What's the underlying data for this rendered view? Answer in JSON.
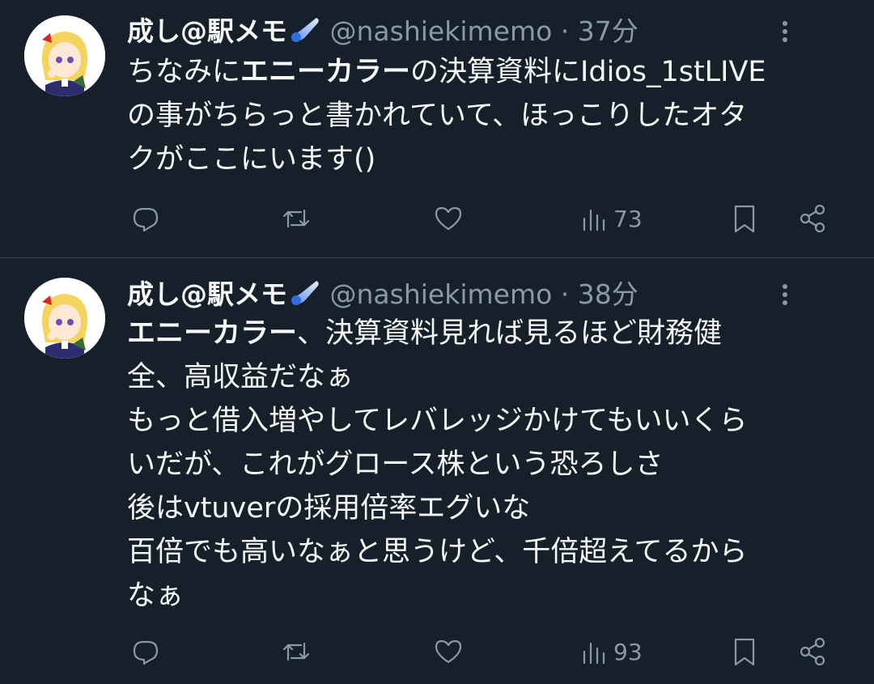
{
  "tweets": [
    {
      "author_name": "成し@駅メモ",
      "badge_icon": "comet-icon",
      "handle": "@nashiekimemo",
      "separator": "·",
      "time": "37分",
      "text_bold": "エニーカラー",
      "text_pre": "ちなみに",
      "text_post": "の決算資料にIdios_1stLIVE\nの事がちらっと書かれていて、ほっこりしたオタ\nクがここにいます()",
      "views": "73"
    },
    {
      "author_name": "成し@駅メモ",
      "badge_icon": "comet-icon",
      "handle": "@nashiekimemo",
      "separator": "·",
      "time": "38分",
      "text_bold": "エニーカラー",
      "text_post": "、決算資料見れば見るほど財務健\n全、高収益だなぁ\nもっと借入増やしてレバレッジかけてもいいくら\nいだが、これがグロース株という恐ろしさ\n後はvtuverの採用倍率エグいな\n百倍でも高いなぁと思うけど、千倍超えてるから\nなぁ",
      "views": "93"
    }
  ],
  "colors": {
    "background": "#15202b",
    "text": "#f7f9f9",
    "muted": "#8b98a5",
    "divider": "#38444d"
  }
}
